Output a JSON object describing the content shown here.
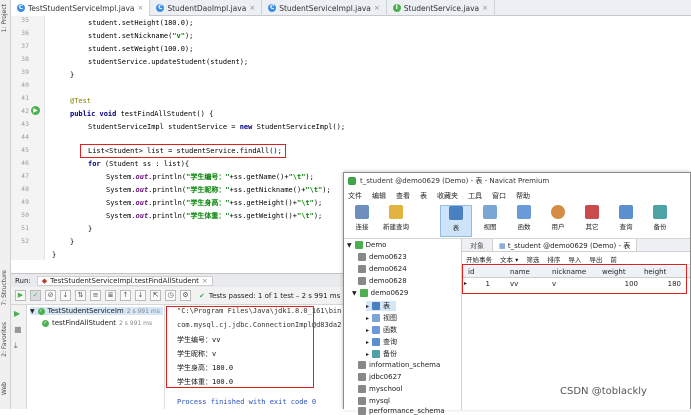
{
  "left_stripe": [
    "1: Project",
    "7: Structure",
    "2: Favorites",
    "Web"
  ],
  "tabs": [
    {
      "label": "TestStudentServiceImpl.java",
      "icon": "class-icon",
      "active": true
    },
    {
      "label": "StudentDaoImpl.java",
      "icon": "class-icon"
    },
    {
      "label": "StudentServiceImpl.java",
      "icon": "class-icon"
    },
    {
      "label": "StudentService.java",
      "icon": "interface-icon"
    }
  ],
  "line_numbers": [
    "35",
    "36",
    "37",
    "38",
    "39",
    "40",
    "41",
    "42",
    "43",
    "44",
    "45",
    "46",
    "47",
    "48",
    "49",
    "50",
    "51",
    "52"
  ],
  "code": {
    "l35": [
      "student.",
      "setHeight",
      "(180.0);"
    ],
    "l36": [
      "student.setNickname(",
      "\"v\"",
      ");"
    ],
    "l37": "student.setWeight(100.0);",
    "l38": "studentService.updateStudent(student);",
    "l39": "}",
    "l41": "@Test",
    "l42": [
      "public void ",
      "testFindAllStudent() {"
    ],
    "l43": [
      "StudentServiceImpl studentService = ",
      "new ",
      "StudentServiceImpl();"
    ],
    "l45": "List<Student> list = studentService.findAll();",
    "l46": [
      "for ",
      "(Student ss : list){"
    ],
    "l47": [
      "System.",
      "out",
      ".println(",
      "\"学生编号：\"",
      "+ss.getName()+",
      "\"\\t\"",
      ");"
    ],
    "l48": [
      "System.",
      "out",
      ".println(",
      "\"学生昵称：\"",
      "+ss.getNickname()+",
      "\"\\t\"",
      ");"
    ],
    "l49": [
      "System.",
      "out",
      ".println(",
      "\"学生身高：\"",
      "+ss.getHeight()+",
      "\"\\t\"",
      ");"
    ],
    "l50": [
      "System.",
      "out",
      ".println(",
      "\"学生体重：\"",
      "+ss.getWeight()+",
      "\"\\t\"",
      ");"
    ],
    "l51": "}",
    "l52": "}",
    "l53": "}"
  },
  "run": {
    "label": "Run:",
    "config": "TestStudentServiceImpl.testFindAllStudent",
    "status": "Tests passed: 1 of 1 test – 2 s 991 ms",
    "tree": [
      {
        "label": "TestStudentServiceIm",
        "time": "2 s 991 ms"
      },
      {
        "label": "testFindAllStudent",
        "time": "2 s 991 ms"
      }
    ],
    "console": [
      "\"C:\\Program Files\\Java\\jdk1.8.0_161\\bin",
      "com.mysql.cj.jdbc.ConnectionImpl@d83da2",
      "学生编号：vv",
      "学生昵称：v",
      "学生身高：180.0",
      "学生体重：100.0",
      "",
      "Process finished with exit code 0"
    ]
  },
  "navicat": {
    "title": "t_student @demo0629 (Demo) - 表 - Navicat Premium",
    "menu": [
      "文件",
      "编辑",
      "查看",
      "表",
      "收藏夹",
      "工具",
      "窗口",
      "帮助"
    ],
    "toolbar": [
      "连接",
      "新建查询",
      "表",
      "视图",
      "函数",
      "用户",
      "其它",
      "查询",
      "备份"
    ],
    "tree": {
      "root": "Demo",
      "dbs_before": [
        "demo0623",
        "demo0624",
        "demo0628"
      ],
      "open_db": "demo0629",
      "open_children": [
        "表",
        "视图",
        "函数",
        "查询",
        "备份"
      ],
      "dbs_after": [
        "information_schema",
        "jdbc0627",
        "myschool",
        "mysql",
        "performance_schema"
      ]
    },
    "tabs": [
      "对象",
      "t_student @demo0629 (Demo) - 表"
    ],
    "grid_toolbar": [
      "开始事务",
      "文本 ▾",
      "筛选",
      "排序",
      "导入",
      "导出",
      "前"
    ],
    "columns": [
      "id",
      "name",
      "nickname",
      "weight",
      "height"
    ],
    "rows": [
      [
        "1",
        "vv",
        "v",
        "100",
        "180"
      ]
    ]
  },
  "watermark": "CSDN @toblackly"
}
